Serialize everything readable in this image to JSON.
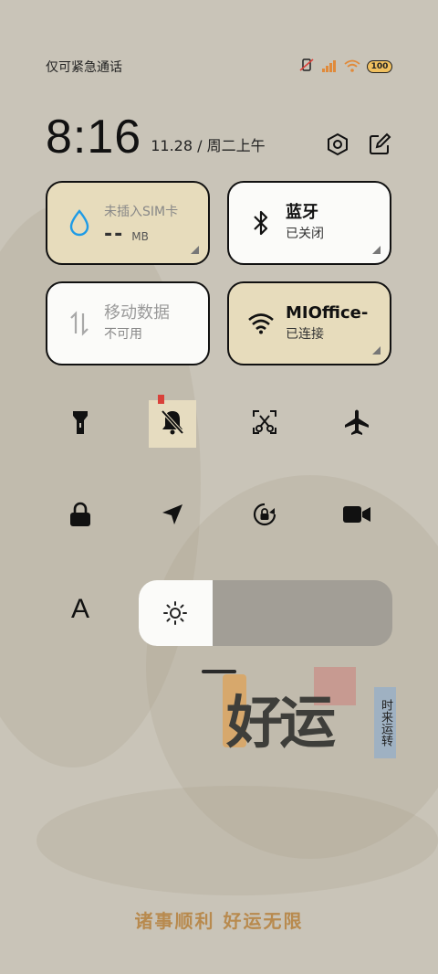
{
  "status_bar": {
    "carrier": "仅可紧急通话",
    "battery": "100",
    "icons": [
      "vibrate-off-icon",
      "signal-icon",
      "wifi-icon",
      "battery-icon"
    ]
  },
  "clock": {
    "time": "8:16",
    "date": "11.28 / 周二上午",
    "actions": [
      "settings-icon",
      "edit-icon"
    ]
  },
  "tiles": {
    "sim": {
      "title": "未插入SIM卡",
      "value": "--",
      "unit": "MB",
      "icon": "water-drop-icon",
      "accent": "#1e9be6"
    },
    "bluetooth": {
      "title": "蓝牙",
      "status": "已关闭",
      "icon": "bluetooth-icon"
    },
    "mobile_data": {
      "title": "移动数据",
      "status": "不可用",
      "icon": "data-arrows-icon"
    },
    "wifi": {
      "title": "MIOffice-",
      "status": "已连接",
      "icon": "wifi-icon"
    }
  },
  "toggles": [
    {
      "name": "flashlight",
      "icon": "flashlight-icon",
      "active": false
    },
    {
      "name": "mute",
      "icon": "bell-off-icon",
      "active": true
    },
    {
      "name": "screenshot",
      "icon": "screenshot-icon",
      "active": false
    },
    {
      "name": "airplane",
      "icon": "airplane-icon",
      "active": false
    },
    {
      "name": "lock",
      "icon": "lock-icon",
      "active": false
    },
    {
      "name": "location",
      "icon": "location-icon",
      "active": false
    },
    {
      "name": "rotation-lock",
      "icon": "rotation-lock-icon",
      "active": false
    },
    {
      "name": "screen-record",
      "icon": "video-camera-icon",
      "active": false
    }
  ],
  "controls": {
    "font_label": "A",
    "brightness_level": 0.29
  },
  "artwork": {
    "main": "好运",
    "side_text": "时来运转"
  },
  "blessing": "诸事顺利  好运无限",
  "colors": {
    "tile_cream": "#e7dcbc",
    "tile_white": "#fbfbf9",
    "background": "#c9c4b8",
    "accent_red": "#d9413a"
  }
}
